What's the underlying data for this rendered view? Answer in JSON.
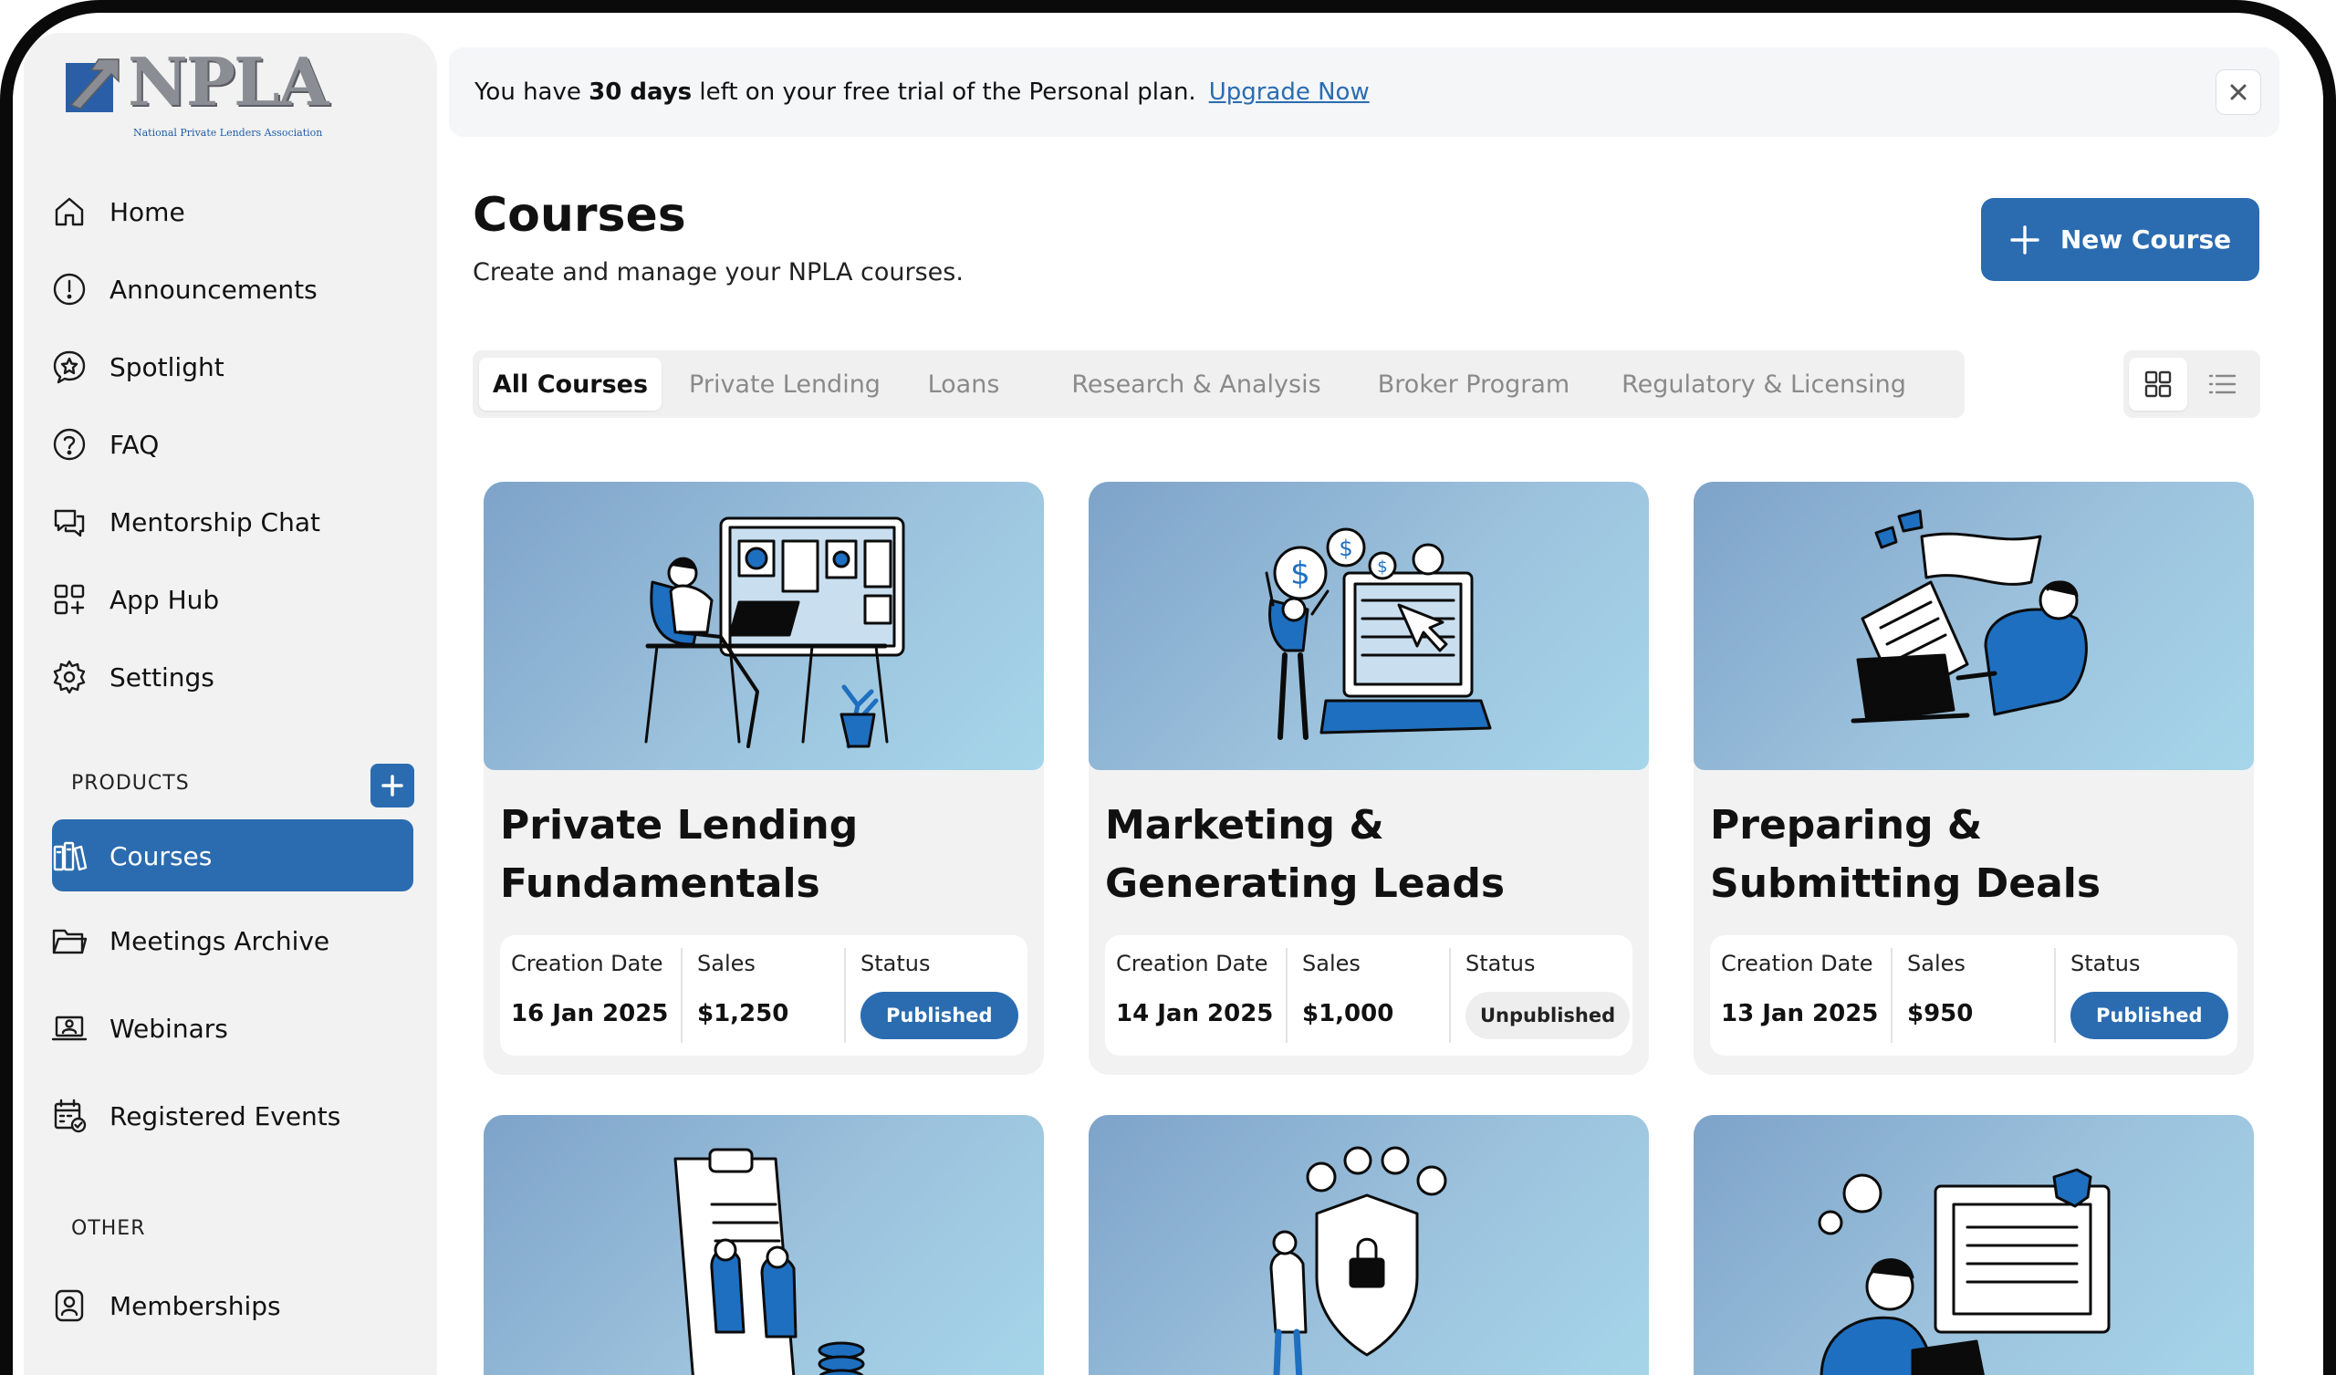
{
  "brand": {
    "logo_text": "NPLA",
    "logo_subtitle": "National Private Lenders Association"
  },
  "sidebar": {
    "nav": [
      {
        "label": "Home",
        "icon": "home-icon"
      },
      {
        "label": "Announcements",
        "icon": "alert-circle-icon"
      },
      {
        "label": "Spotlight",
        "icon": "star-chat-icon"
      },
      {
        "label": "FAQ",
        "icon": "question-circle-icon"
      },
      {
        "label": "Mentorship Chat",
        "icon": "chat-bubbles-icon"
      },
      {
        "label": "App Hub",
        "icon": "app-grid-icon"
      },
      {
        "label": "Settings",
        "icon": "gear-icon"
      }
    ],
    "products_label": "PRODUCTS",
    "products": [
      {
        "label": "Courses",
        "icon": "books-icon",
        "active": true
      },
      {
        "label": "Meetings Archive",
        "icon": "folder-icon"
      },
      {
        "label": "Webinars",
        "icon": "laptop-user-icon"
      },
      {
        "label": "Registered Events",
        "icon": "calendar-check-icon"
      }
    ],
    "other_label": "OTHER",
    "other": [
      {
        "label": "Memberships",
        "icon": "member-card-icon"
      }
    ]
  },
  "banner": {
    "prefix": "You have",
    "days": "30 days",
    "suffix": "left on your free trial of the Personal plan.",
    "link": "Upgrade Now"
  },
  "page": {
    "title": "Courses",
    "subtitle": "Create and manage your NPLA courses.",
    "new_button": "New Course"
  },
  "tabs": [
    {
      "label": "All Courses",
      "active": true
    },
    {
      "label": "Private Lending"
    },
    {
      "label": "Loans"
    },
    {
      "label": "Research & Analysis"
    },
    {
      "label": "Broker Program"
    },
    {
      "label": "Regulatory & Licensing"
    }
  ],
  "view_mode": "grid",
  "stat_labels": {
    "date": "Creation Date",
    "sales": "Sales",
    "status": "Status"
  },
  "courses": [
    {
      "title": "Private Lending Fundamentals",
      "date": "16 Jan 2025",
      "sales": "$1,250",
      "status": "Published"
    },
    {
      "title": "Marketing & Generating Leads",
      "date": "14 Jan 2025",
      "sales": "$1,000",
      "status": "Unpublished"
    },
    {
      "title": "Preparing & Submitting Deals",
      "date": "13 Jan 2025",
      "sales": "$950",
      "status": "Published"
    }
  ],
  "colors": {
    "accent": "#2b6cb0",
    "sidebar_bg": "#f2f2f2",
    "banner_bg": "#f4f6f8"
  }
}
